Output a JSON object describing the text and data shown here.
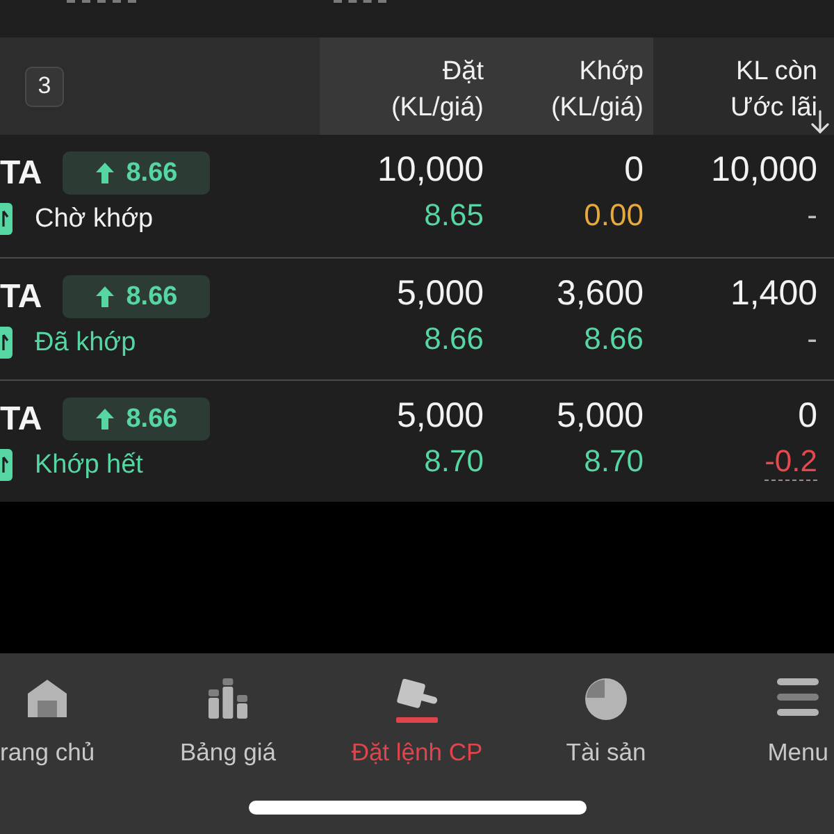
{
  "header": {
    "order_count": "3",
    "columns": [
      {
        "title": "Đặt",
        "subtitle": "(KL/giá)",
        "sorted": false
      },
      {
        "title": "Khớp",
        "subtitle": "(KL/giá)",
        "sorted": false
      },
      {
        "title": "KL còn",
        "subtitle": "Ước lãi",
        "sorted": true
      }
    ]
  },
  "orders": [
    {
      "symbol": "TA",
      "last_price": {
        "text": "8.66",
        "kind": "up"
      },
      "status": {
        "text": "Chờ khớp",
        "kind": "pending"
      },
      "placed": {
        "qty": "10,000",
        "price": {
          "text": "8.65",
          "kind": "up"
        }
      },
      "matched": {
        "qty": "0",
        "price": {
          "text": "0.00",
          "kind": "reference"
        }
      },
      "remaining": {
        "qty": "10,000",
        "profit": {
          "text": "-",
          "kind": "none",
          "underlined": false
        }
      }
    },
    {
      "symbol": "TA",
      "last_price": {
        "text": "8.66",
        "kind": "up"
      },
      "status": {
        "text": "Đã khớp",
        "kind": "matched"
      },
      "placed": {
        "qty": "5,000",
        "price": {
          "text": "8.66",
          "kind": "up"
        }
      },
      "matched": {
        "qty": "3,600",
        "price": {
          "text": "8.66",
          "kind": "up"
        }
      },
      "remaining": {
        "qty": "1,400",
        "profit": {
          "text": "-",
          "kind": "none",
          "underlined": false
        }
      }
    },
    {
      "symbol": "TA",
      "last_price": {
        "text": "8.66",
        "kind": "up"
      },
      "status": {
        "text": "Khớp hết",
        "kind": "filled"
      },
      "placed": {
        "qty": "5,000",
        "price": {
          "text": "8.70",
          "kind": "up"
        }
      },
      "matched": {
        "qty": "5,000",
        "price": {
          "text": "8.70",
          "kind": "up"
        }
      },
      "remaining": {
        "qty": "0",
        "profit": {
          "text": "-0.2",
          "kind": "down",
          "underlined": true
        }
      }
    }
  ],
  "nav": {
    "items": [
      {
        "label": "rang chủ",
        "kind": "home",
        "selected": false
      },
      {
        "label": "Bảng giá",
        "kind": "price_board",
        "selected": false
      },
      {
        "label": "Đặt lệnh CP",
        "kind": "order",
        "selected": true
      },
      {
        "label": "Tài sản",
        "kind": "assets",
        "selected": false
      },
      {
        "label": "Menu",
        "kind": "menu",
        "selected": false
      }
    ]
  }
}
